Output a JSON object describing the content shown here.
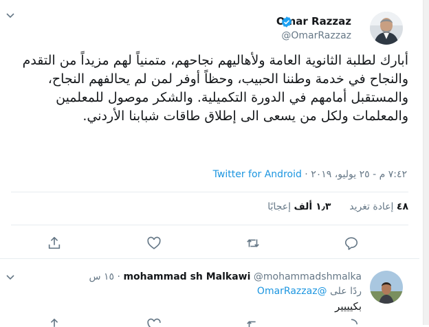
{
  "tweet": {
    "author_name": "Omar Razzaz",
    "author_handle": "@OmarRazzaz",
    "text": "أبارك لطلبة الثانوية العامة ولأهاليهم نجاحهم، متمنياً لهم مزيداً من التقدم والنجاح في خدمة وطننا الحبيب، وحظاً أوفر لمن لم يحالفهم النجاح، والمستقبل أمامهم في الدورة التكميلية. والشكر موصول للمعلمين والمعلمات ولكل من يسعى الى إطلاق طاقات شبابنا الأردني.",
    "time": "٧:٤٢ م",
    "date": "٢٥ يوليو، ٢٠١٩",
    "source": "Twitter for Android",
    "retweets_count": "٤٨",
    "retweets_label": "إعادة تغريد",
    "likes_count": "١٫٣ ألف",
    "likes_label": "إعجابًا"
  },
  "reply": {
    "author_name": "mohammad sh Malkawi",
    "author_handle": "@mohammadshmalka",
    "time": "١٥ س",
    "reply_prefix": "ردًا على",
    "reply_to": "@OmarRazzaz",
    "text": "بكيييير"
  },
  "icons": {
    "reply": "reply-icon",
    "retweet": "retweet-icon",
    "like": "heart-icon",
    "share": "share-icon",
    "menu": "chevron-down-icon",
    "verified": "verified-badge-icon"
  },
  "colors": {
    "accent": "#1b95e0",
    "text": "#14171a",
    "muted": "#657786"
  }
}
